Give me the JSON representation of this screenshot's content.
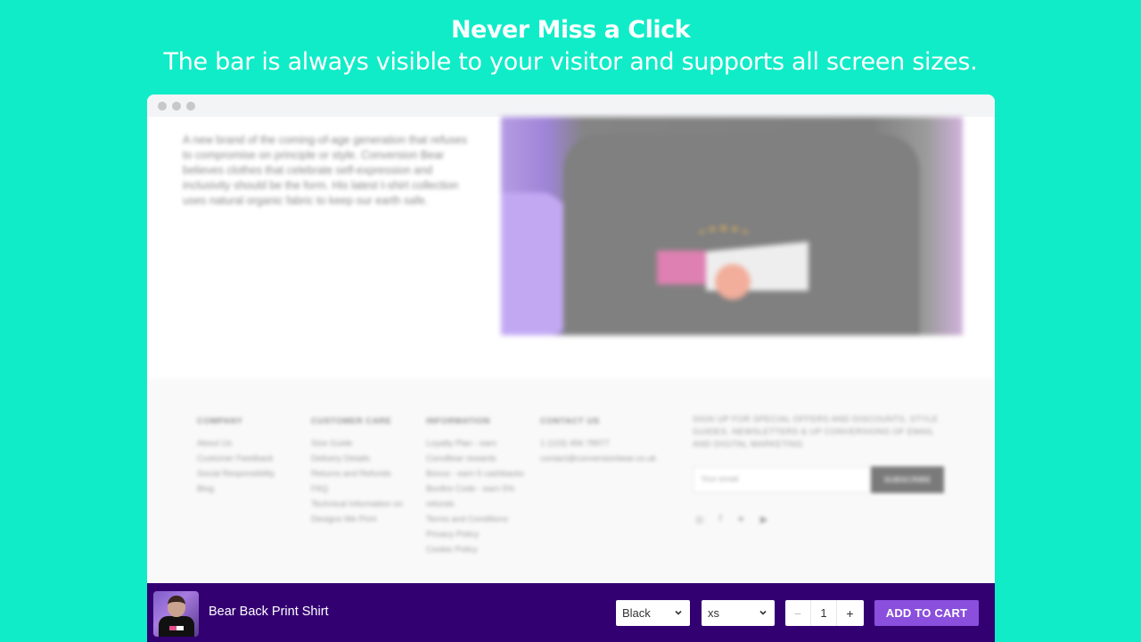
{
  "hero": {
    "title": "Never Miss a Click",
    "subtitle": "The bar is always visible to your visitor and supports all screen sizes."
  },
  "colors": {
    "background": "#10ecc8",
    "sticky_bar": "#330072",
    "add_to_cart": "#8a4fdc"
  },
  "page": {
    "intro_text": "A new brand of the coming-of-age generation that refuses to compromise on principle or style. Conversion Bear believes clothes that celebrate self-expression and inclusivity should be the form. His latest t-shirt collection uses natural organic fabric to keep our earth safe.",
    "footer": {
      "columns": [
        {
          "heading": "COMPANY",
          "links": [
            "About Us",
            "Customer Feedback",
            "Social Responsibility",
            "Blog"
          ]
        },
        {
          "heading": "CUSTOMER CARE",
          "links": [
            "Size Guide",
            "Delivery Details",
            "Returns and Refunds",
            "FAQ",
            "Technical Information on Designs We Print"
          ]
        },
        {
          "heading": "INFORMATION",
          "links": [
            "Loyalty Plan - earn ConvBear rewards",
            "Bonus - earn 5 cashbacks",
            "Bonfire Code - earn 5% refunds",
            "Terms and Conditions",
            "Privacy Policy",
            "Cookie Policy"
          ]
        },
        {
          "heading": "CONTACT US",
          "links": [
            "1 (123) 456 78977",
            "contact@conversionbear.co.uk"
          ]
        }
      ],
      "newsletter_text": "SIGN UP FOR SPECIAL OFFERS AND DISCOUNTS, STYLE GUIDES, NEWSLETTERS & UP CONVERSIONS OF EMAIL AND DIGITAL MARKETING",
      "newsletter_placeholder": "Your email",
      "subscribe_label": "SUBSCRIBE",
      "socials": [
        "instagram-icon",
        "facebook-icon",
        "twitter-icon",
        "youtube-icon"
      ]
    }
  },
  "sticky_bar": {
    "product_name": "Bear Back Print Shirt",
    "color_select": {
      "selected": "Black"
    },
    "size_select": {
      "selected": "xs"
    },
    "quantity": {
      "minus": "−",
      "value": "1",
      "plus": "+"
    },
    "add_to_cart_label": "ADD TO CART"
  }
}
